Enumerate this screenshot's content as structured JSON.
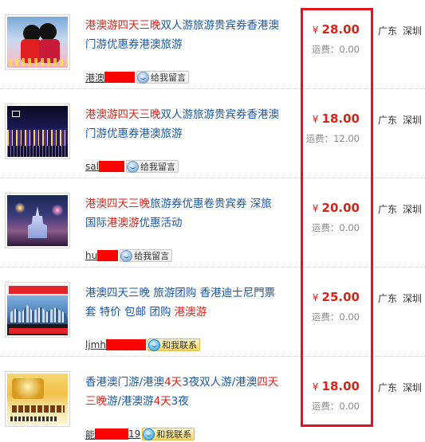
{
  "items": [
    {
      "title": [
        {
          "t": "港澳游四天三晚",
          "hl": true
        },
        {
          "t": "双人游旅游贵宾券香港澳门游优惠券港澳旅游",
          "hl": false
        }
      ],
      "seller_name": "港澳",
      "redact_width": 38,
      "action_label": "给我留言",
      "action_type": "message",
      "currency": "¥",
      "price": "28.00",
      "shipping": "运费：0.00",
      "province": "广东",
      "city": "深圳"
    },
    {
      "title": [
        {
          "t": "港澳游四天三晚",
          "hl": true
        },
        {
          "t": "双人游旅游贵宾券香港澳门游优惠券港澳旅游",
          "hl": false
        }
      ],
      "seller_name": "sal",
      "redact_width": 32,
      "action_label": "给我留言",
      "action_type": "message",
      "currency": "¥",
      "price": "18.00",
      "shipping": "运费：12.00",
      "province": "广东",
      "city": "深圳"
    },
    {
      "title": [
        {
          "t": "港澳四天三晚",
          "hl": true
        },
        {
          "t": "旅游券优惠卷贵宾券 深旅国际",
          "hl": false
        },
        {
          "t": "港澳游",
          "hl": true
        },
        {
          "t": "优惠活动",
          "hl": false
        }
      ],
      "seller_name": "hu",
      "redact_width": 26,
      "action_label": "给我留言",
      "action_type": "message",
      "currency": "¥",
      "price": "20.00",
      "shipping": "运费：0.00",
      "province": "广东",
      "city": "深圳"
    },
    {
      "title": [
        {
          "t": "港澳四天三晚 旅游团购 香港迪士尼門票套 特价 包邮 团购 ",
          "hl": false
        },
        {
          "t": "港澳游",
          "hl": true
        }
      ],
      "seller_name": "ljmh",
      "redact_width": 50,
      "action_label": "和我联系",
      "action_type": "contact",
      "currency": "¥",
      "price": "25.00",
      "shipping": "运费：0.00",
      "province": "广东",
      "city": "深圳"
    },
    {
      "title": [
        {
          "t": "香港澳门游/港澳",
          "hl": false
        },
        {
          "t": "4天",
          "hl": true
        },
        {
          "t": "3夜双人游/港澳",
          "hl": false
        },
        {
          "t": "四天三晚",
          "hl": true
        },
        {
          "t": "游/港澳游",
          "hl": false
        },
        {
          "t": "4天",
          "hl": true
        },
        {
          "t": "3夜",
          "hl": false
        }
      ],
      "seller_name": "能",
      "redact_width": 42,
      "seller_suffix": "19",
      "action_label": "和我联系",
      "action_type": "contact",
      "currency": "¥",
      "price": "18.00",
      "shipping": "运费：0.00",
      "province": "广东",
      "city": "深圳"
    }
  ],
  "colors": {
    "link": "#1b57a5",
    "highlight": "#d8231b",
    "price": "#d8231b",
    "annotation_frame": "#e3131b"
  },
  "icons": [
    "chat-bubble-icon",
    "product-thumbnail"
  ]
}
